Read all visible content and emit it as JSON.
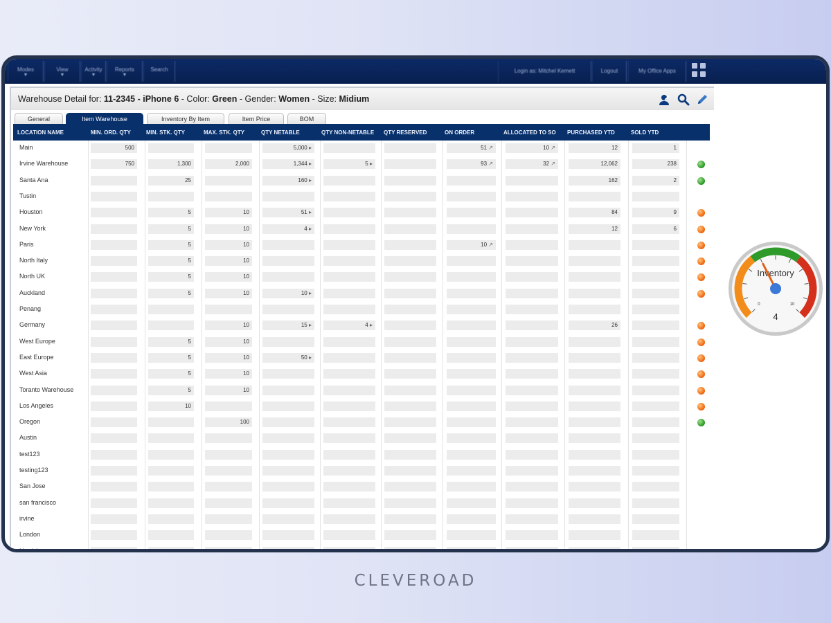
{
  "topbar": {
    "nav_items": [
      {
        "label": "Modes",
        "dd": "▼"
      },
      {
        "label": "View",
        "dd": "▼"
      },
      {
        "label": "Activity",
        "dd": "▼"
      },
      {
        "label": "Reports",
        "dd": "▼"
      },
      {
        "label": "Search",
        "dd": ""
      }
    ],
    "login_label": "Login as: Mitchel Kemett",
    "logout_label": "Logout",
    "office_apps_label": "My Office Apps"
  },
  "header": {
    "prefix": "Warehouse Detail for:",
    "item_code": "11-2345 - iPhone 6",
    "color_label": "- Color:",
    "color_value": "Green",
    "gender_label": "- Gender:",
    "gender_value": "Women",
    "size_label": "- Size:",
    "size_value": "Midium",
    "icons": [
      "user-icon",
      "search-icon",
      "edit-icon"
    ]
  },
  "tabs": [
    {
      "label": "General",
      "active": false
    },
    {
      "label": "Item Warehouse",
      "active": true
    },
    {
      "label": "Inventory By Item",
      "active": false
    },
    {
      "label": "Item Price",
      "active": false
    },
    {
      "label": "BOM",
      "active": false
    }
  ],
  "columns": [
    "LOCATION NAME",
    "MIN. ORD. QTY",
    "MIN. STK. QTY",
    "MAX. STK. QTY",
    "QTY NETABLE",
    "QTY NON-NETABLE",
    "QTY RESERVED",
    "ON ORDER",
    "ALLOCATED TO SO",
    "PURCHASED YTD",
    "SOLD YTD"
  ],
  "rows": [
    {
      "loc": "Main",
      "v": [
        "500",
        "",
        "",
        "5,000",
        "",
        "",
        "51",
        "10",
        "12",
        "1"
      ],
      "status": ""
    },
    {
      "loc": "Irvine Warehouse",
      "v": [
        "750",
        "1,300",
        "2,000",
        "1,344",
        "5",
        "",
        "93",
        "32",
        "12,062",
        "238"
      ],
      "status": "green"
    },
    {
      "loc": "Santa Ana",
      "v": [
        "",
        "25",
        "",
        "160",
        "",
        "",
        "",
        "",
        "162",
        "2"
      ],
      "status": "green"
    },
    {
      "loc": "Tustin",
      "v": [
        "",
        "",
        "",
        "",
        "",
        "",
        "",
        "",
        "",
        ""
      ],
      "status": ""
    },
    {
      "loc": "Houston",
      "v": [
        "",
        "5",
        "10",
        "51",
        "",
        "",
        "",
        "",
        "84",
        "9"
      ],
      "status": "orange"
    },
    {
      "loc": "New York",
      "v": [
        "",
        "5",
        "10",
        "4",
        "",
        "",
        "",
        "",
        "12",
        "6"
      ],
      "status": "orange"
    },
    {
      "loc": "Paris",
      "v": [
        "",
        "5",
        "10",
        "",
        "",
        "",
        "10",
        "",
        "",
        ""
      ],
      "status": "orange"
    },
    {
      "loc": "North Italy",
      "v": [
        "",
        "5",
        "10",
        "",
        "",
        "",
        "",
        "",
        "",
        ""
      ],
      "status": "orange"
    },
    {
      "loc": "North UK",
      "v": [
        "",
        "5",
        "10",
        "",
        "",
        "",
        "",
        "",
        "",
        ""
      ],
      "status": "orange"
    },
    {
      "loc": "Auckland",
      "v": [
        "",
        "5",
        "10",
        "10",
        "",
        "",
        "",
        "",
        "",
        ""
      ],
      "status": "orange"
    },
    {
      "loc": "Penang",
      "v": [
        "",
        "",
        "",
        "",
        "",
        "",
        "",
        "",
        "",
        ""
      ],
      "status": ""
    },
    {
      "loc": "Germany",
      "v": [
        "",
        "",
        "10",
        "15",
        "4",
        "",
        "",
        "",
        "26",
        ""
      ],
      "status": "orange"
    },
    {
      "loc": "West Europe",
      "v": [
        "",
        "5",
        "10",
        "",
        "",
        "",
        "",
        "",
        "",
        ""
      ],
      "status": "orange"
    },
    {
      "loc": "East Europe",
      "v": [
        "",
        "5",
        "10",
        "50",
        "",
        "",
        "",
        "",
        "",
        ""
      ],
      "status": "orange"
    },
    {
      "loc": "West Asia",
      "v": [
        "",
        "5",
        "10",
        "",
        "",
        "",
        "",
        "",
        "",
        ""
      ],
      "status": "orange"
    },
    {
      "loc": "Toranto Warehouse",
      "v": [
        "",
        "5",
        "10",
        "",
        "",
        "",
        "",
        "",
        "",
        ""
      ],
      "status": "orange"
    },
    {
      "loc": "Los Angeles",
      "v": [
        "",
        "10",
        "",
        "",
        "",
        "",
        "",
        "",
        "",
        ""
      ],
      "status": "orange"
    },
    {
      "loc": "Oregon",
      "v": [
        "",
        "",
        "100",
        "",
        "",
        "",
        "",
        "",
        "",
        ""
      ],
      "status": "green"
    },
    {
      "loc": "Austin",
      "v": [
        "",
        "",
        "",
        "",
        "",
        "",
        "",
        "",
        "",
        ""
      ],
      "status": ""
    },
    {
      "loc": "test123",
      "v": [
        "",
        "",
        "",
        "",
        "",
        "",
        "",
        "",
        "",
        ""
      ],
      "status": ""
    },
    {
      "loc": "testing123",
      "v": [
        "",
        "",
        "",
        "",
        "",
        "",
        "",
        "",
        "",
        ""
      ],
      "status": ""
    },
    {
      "loc": "San Jose",
      "v": [
        "",
        "",
        "",
        "",
        "",
        "",
        "",
        "",
        "",
        ""
      ],
      "status": ""
    },
    {
      "loc": "san francisco",
      "v": [
        "",
        "",
        "",
        "",
        "",
        "",
        "",
        "",
        "",
        ""
      ],
      "status": ""
    },
    {
      "loc": "irvine",
      "v": [
        "",
        "",
        "",
        "",
        "",
        "",
        "",
        "",
        "",
        ""
      ],
      "status": ""
    },
    {
      "loc": "London",
      "v": [
        "",
        "",
        "",
        "",
        "",
        "",
        "",
        "",
        "",
        ""
      ],
      "status": ""
    },
    {
      "loc": "Munich",
      "v": [
        "",
        "",
        "",
        "",
        "",
        "",
        "",
        "",
        "",
        ""
      ],
      "status": ""
    }
  ],
  "gauge": {
    "label": "Inventory",
    "value": 4,
    "value_text": "4",
    "min_label": "0",
    "max_label": "10",
    "colors": {
      "low": "#f28c1a",
      "mid": "#2e9a2a",
      "high": "#d4301c",
      "needle": "#e0601a",
      "hub": "#3b78d8"
    }
  },
  "brand": {
    "text": "CLEVEROAD"
  },
  "colors": {
    "navy": "#08306b",
    "frame": "#24324e",
    "status_green": "#2e9a2a",
    "status_orange": "#f06a14"
  }
}
